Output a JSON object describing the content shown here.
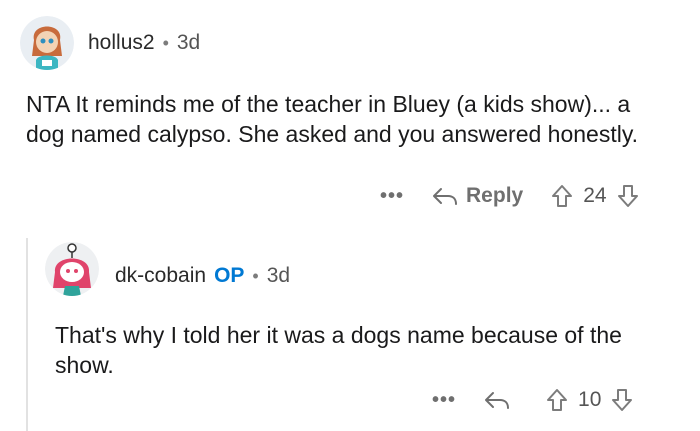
{
  "comments": [
    {
      "username": "hollus2",
      "op": "",
      "separator": "•",
      "age": "3d",
      "body": "NTA It reminds me of the teacher in Bluey (a kids show)... a dog named calypso. She asked and you answered honestly.",
      "actions": {
        "more": "•••",
        "reply_label": "Reply",
        "score": "24"
      }
    },
    {
      "username": "dk-cobain",
      "op": "OP",
      "separator": "•",
      "age": "3d",
      "body": "That's why I told her it was a dogs name because of the show.",
      "actions": {
        "more": "•••",
        "reply_label": "",
        "score": "10"
      }
    }
  ],
  "colors": {
    "op_badge": "#0079d3",
    "muted": "#7c7c7c"
  },
  "icons": {
    "reply": "reply-arrow-icon",
    "upvote": "upvote-arrow-icon",
    "downvote": "downvote-arrow-icon"
  }
}
